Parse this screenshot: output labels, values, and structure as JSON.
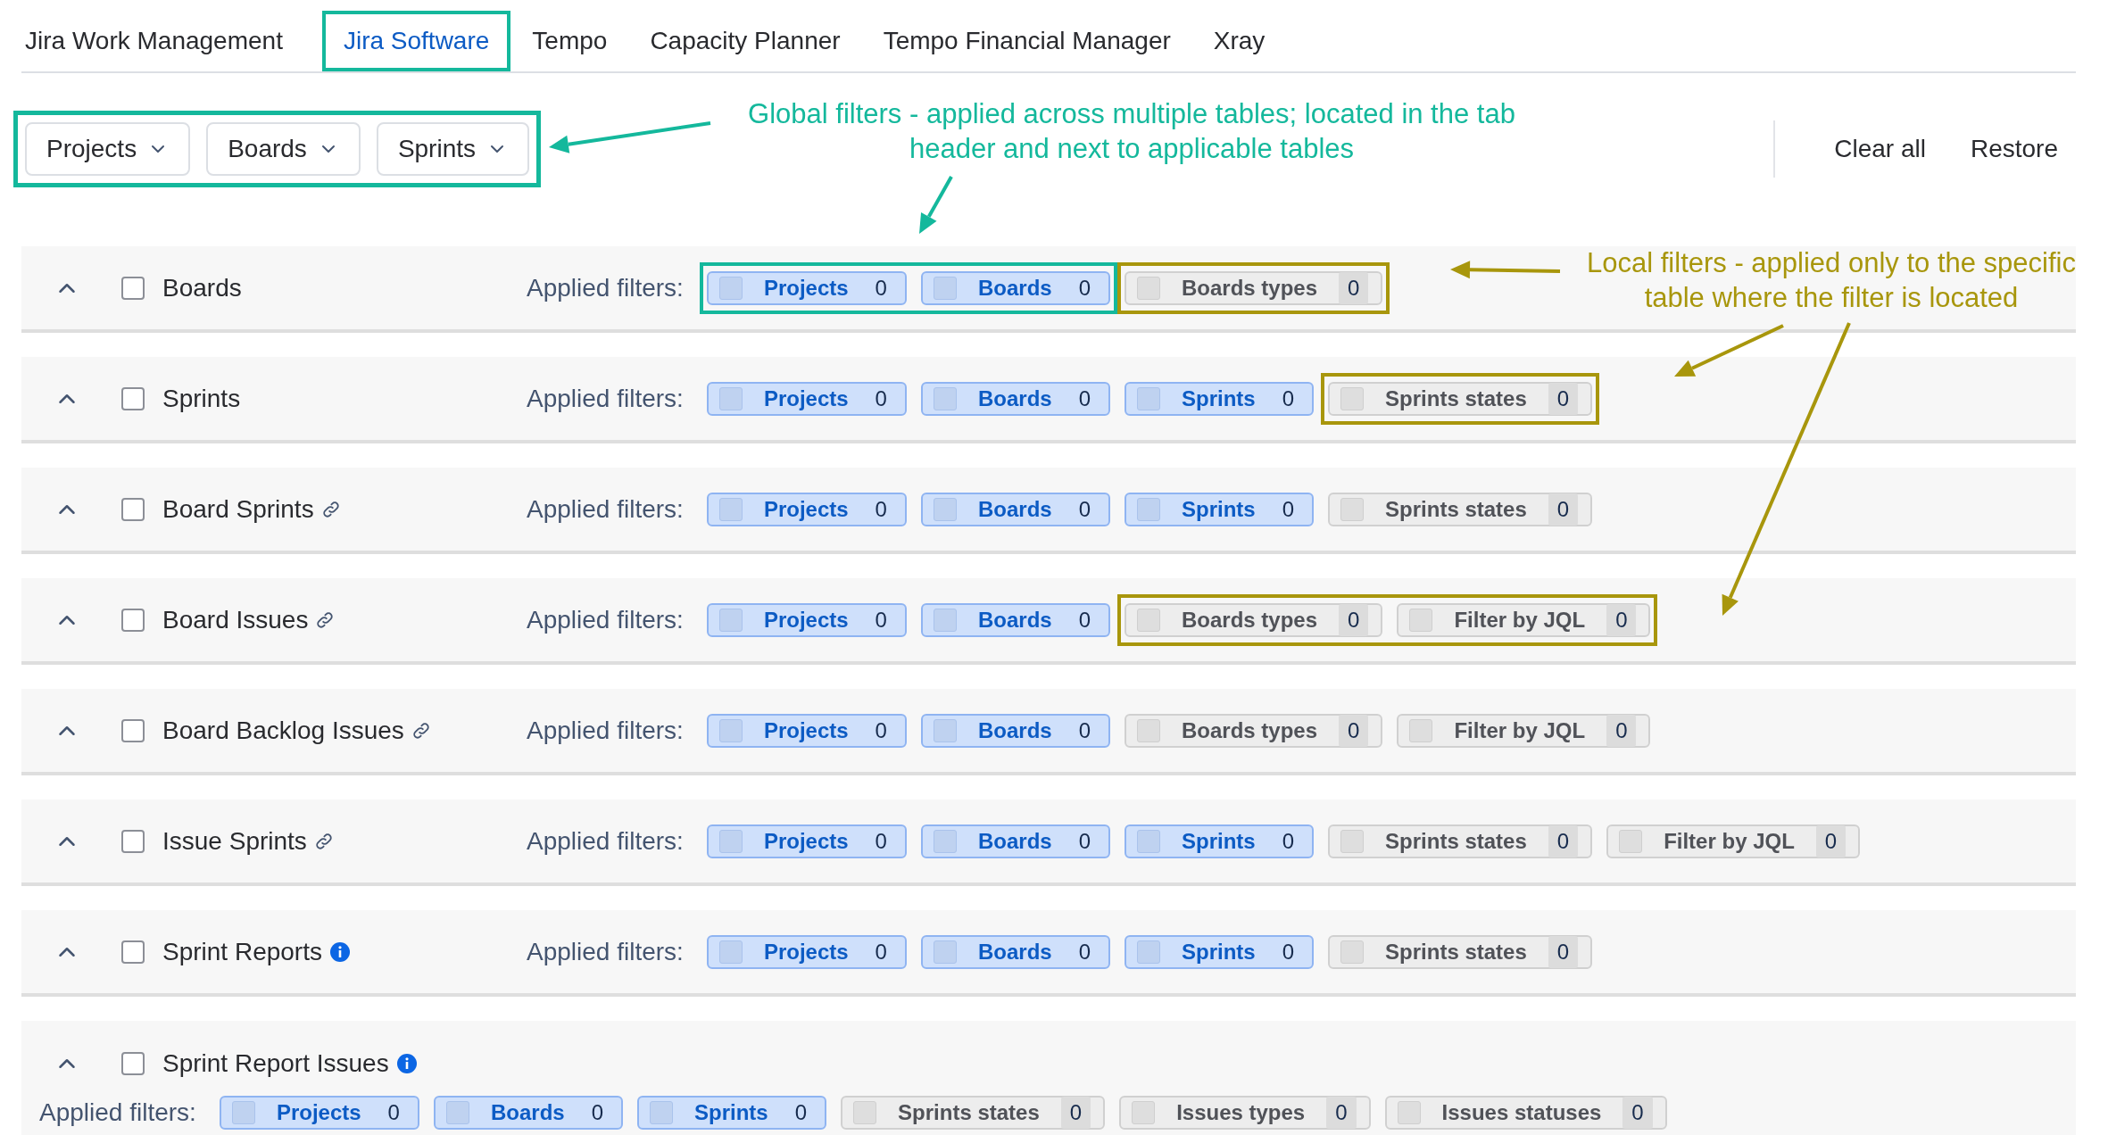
{
  "tabs": [
    {
      "label": "Jira Work Management",
      "selected": false,
      "highlighted": false
    },
    {
      "label": "Jira Software",
      "selected": true,
      "highlighted": true
    },
    {
      "label": "Tempo",
      "selected": false,
      "highlighted": false
    },
    {
      "label": "Capacity Planner",
      "selected": false,
      "highlighted": false
    },
    {
      "label": "Tempo Financial Manager",
      "selected": false,
      "highlighted": false
    },
    {
      "label": "Xray",
      "selected": false,
      "highlighted": false
    }
  ],
  "global_filters": {
    "highlighted": true,
    "buttons": [
      "Projects",
      "Boards",
      "Sprints"
    ]
  },
  "actions": [
    "Clear all",
    "Restore"
  ],
  "annotations": [
    {
      "kind": "global",
      "text": "Global filters - applied across multiple tables; located in the tab header and next to applicable tables"
    },
    {
      "kind": "local",
      "text": "Local filters - applied only to the specific table where the filter is located"
    }
  ],
  "tables": [
    {
      "title": "Boards",
      "kind": "plain",
      "checked": false,
      "expanded": true,
      "filters_label": "Applied filters:",
      "groups": [
        {
          "kind": "global",
          "chips": [
            {
              "kind": "global",
              "label": "Projects",
              "count": "0"
            },
            {
              "kind": "global",
              "label": "Boards",
              "count": "0"
            }
          ]
        },
        {
          "kind": "local",
          "chips": [
            {
              "kind": "local",
              "label": "Boards types",
              "count": "0"
            }
          ]
        }
      ]
    },
    {
      "title": "Sprints",
      "kind": "plain",
      "checked": false,
      "expanded": true,
      "filters_label": "Applied filters:",
      "groups": [
        {
          "kind": "plain",
          "chips": [
            {
              "kind": "global",
              "label": "Projects",
              "count": "0"
            },
            {
              "kind": "global",
              "label": "Boards",
              "count": "0"
            },
            {
              "kind": "global",
              "label": "Sprints",
              "count": "0"
            }
          ]
        },
        {
          "kind": "local",
          "chips": [
            {
              "kind": "local",
              "label": "Sprints states",
              "count": "0"
            }
          ]
        }
      ]
    },
    {
      "title": "Board Sprints",
      "kind": "link",
      "checked": false,
      "expanded": true,
      "filters_label": "Applied filters:",
      "groups": [
        {
          "kind": "plain",
          "chips": [
            {
              "kind": "global",
              "label": "Projects",
              "count": "0"
            },
            {
              "kind": "global",
              "label": "Boards",
              "count": "0"
            },
            {
              "kind": "global",
              "label": "Sprints",
              "count": "0"
            },
            {
              "kind": "local",
              "label": "Sprints states",
              "count": "0"
            }
          ]
        }
      ]
    },
    {
      "title": "Board Issues",
      "kind": "link",
      "checked": false,
      "expanded": true,
      "filters_label": "Applied filters:",
      "groups": [
        {
          "kind": "plain",
          "chips": [
            {
              "kind": "global",
              "label": "Projects",
              "count": "0"
            },
            {
              "kind": "global",
              "label": "Boards",
              "count": "0"
            }
          ]
        },
        {
          "kind": "local",
          "chips": [
            {
              "kind": "local",
              "label": "Boards types",
              "count": "0"
            },
            {
              "kind": "local",
              "label": "Filter by JQL",
              "count": "0"
            }
          ]
        }
      ]
    },
    {
      "title": "Board Backlog Issues",
      "kind": "link",
      "checked": false,
      "expanded": true,
      "filters_label": "Applied filters:",
      "groups": [
        {
          "kind": "plain",
          "chips": [
            {
              "kind": "global",
              "label": "Projects",
              "count": "0"
            },
            {
              "kind": "global",
              "label": "Boards",
              "count": "0"
            },
            {
              "kind": "local",
              "label": "Boards types",
              "count": "0"
            },
            {
              "kind": "local",
              "label": "Filter by JQL",
              "count": "0"
            }
          ]
        }
      ]
    },
    {
      "title": "Issue Sprints",
      "kind": "link",
      "checked": false,
      "expanded": true,
      "filters_label": "Applied filters:",
      "groups": [
        {
          "kind": "plain",
          "chips": [
            {
              "kind": "global",
              "label": "Projects",
              "count": "0"
            },
            {
              "kind": "global",
              "label": "Boards",
              "count": "0"
            },
            {
              "kind": "global",
              "label": "Sprints",
              "count": "0"
            },
            {
              "kind": "local",
              "label": "Sprints states",
              "count": "0"
            },
            {
              "kind": "local",
              "label": "Filter by JQL",
              "count": "0"
            }
          ]
        }
      ]
    },
    {
      "title": "Sprint Reports",
      "kind": "info",
      "checked": false,
      "expanded": true,
      "filters_label": "Applied filters:",
      "groups": [
        {
          "kind": "plain",
          "chips": [
            {
              "kind": "global",
              "label": "Projects",
              "count": "0"
            },
            {
              "kind": "global",
              "label": "Boards",
              "count": "0"
            },
            {
              "kind": "global",
              "label": "Sprints",
              "count": "0"
            },
            {
              "kind": "local",
              "label": "Sprints states",
              "count": "0"
            }
          ]
        }
      ]
    },
    {
      "title": "Sprint Report Issues",
      "kind": "info-stacked",
      "checked": false,
      "expanded": true,
      "filters_label": "Applied filters:",
      "groups": [
        {
          "kind": "plain",
          "chips": [
            {
              "kind": "global",
              "label": "Projects",
              "count": "0"
            },
            {
              "kind": "global",
              "label": "Boards",
              "count": "0"
            },
            {
              "kind": "global",
              "label": "Sprints",
              "count": "0"
            },
            {
              "kind": "local",
              "label": "Sprints states",
              "count": "0"
            },
            {
              "kind": "local",
              "label": "Issues types",
              "count": "0"
            },
            {
              "kind": "local",
              "label": "Issues statuses",
              "count": "0"
            }
          ]
        }
      ]
    }
  ]
}
